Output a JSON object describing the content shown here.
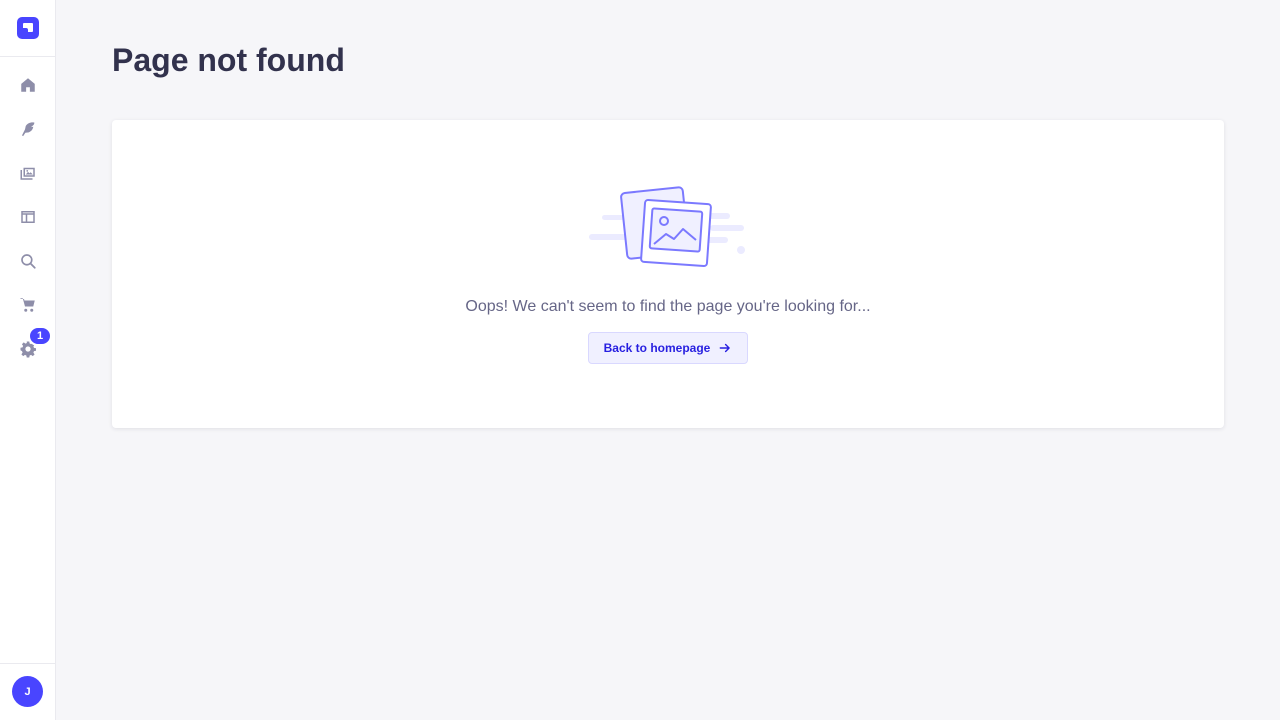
{
  "sidebar": {
    "logo_icon": "app-logo-icon",
    "items": [
      {
        "name": "home",
        "icon": "home-icon"
      },
      {
        "name": "content-type-builder",
        "icon": "feather-icon"
      },
      {
        "name": "media-library",
        "icon": "images-icon"
      },
      {
        "name": "content-manager",
        "icon": "layout-icon"
      },
      {
        "name": "search",
        "icon": "search-icon"
      },
      {
        "name": "marketplace",
        "icon": "cart-icon"
      },
      {
        "name": "settings",
        "icon": "gear-icon"
      }
    ],
    "settings_badge": "1",
    "avatar_initial": "J"
  },
  "page": {
    "title": "Page not found"
  },
  "card": {
    "message": "Oops! We can't seem to find the page you're looking for...",
    "button_label": "Back to homepage",
    "button_icon": "arrow-right-icon"
  },
  "colors": {
    "accent": "#4945ff",
    "background": "#f6f6f9",
    "icon": "#8e8ea9",
    "button_bg": "#f0f0ff",
    "button_text": "#271fe0"
  }
}
